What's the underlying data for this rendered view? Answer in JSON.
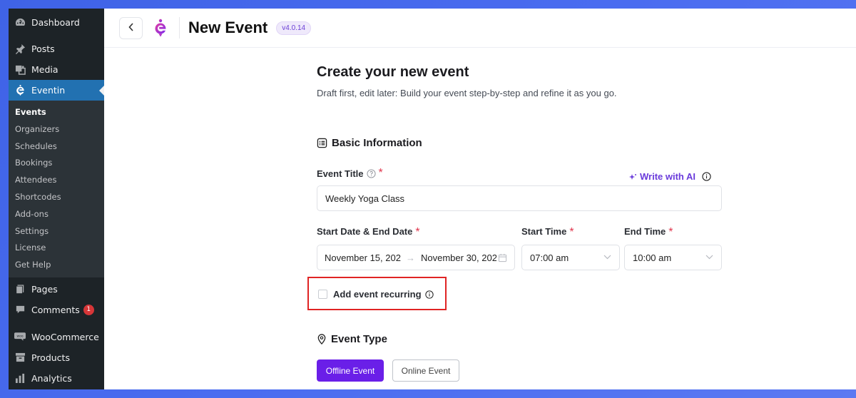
{
  "sidebar": {
    "items_top": [
      {
        "label": "Dashboard",
        "icon": "dashboard-icon"
      },
      {
        "label": "Posts",
        "icon": "pin-icon"
      },
      {
        "label": "Media",
        "icon": "media-icon"
      },
      {
        "label": "Eventin",
        "icon": "eventin-icon"
      }
    ],
    "submenu": [
      "Events",
      "Organizers",
      "Schedules",
      "Bookings",
      "Attendees",
      "Shortcodes",
      "Add-ons",
      "Settings",
      "License",
      "Get Help"
    ],
    "items_bottom": [
      {
        "label": "Pages",
        "icon": "pages-icon"
      },
      {
        "label": "Comments",
        "icon": "comments-icon",
        "count": "1"
      },
      {
        "label": "WooCommerce",
        "icon": "woocommerce-icon"
      },
      {
        "label": "Products",
        "icon": "products-icon"
      },
      {
        "label": "Analytics",
        "icon": "analytics-icon"
      }
    ]
  },
  "header": {
    "back_icon": "‹",
    "title": "New Event",
    "version": "v4.0.14"
  },
  "main": {
    "heading": "Create your new event",
    "subtitle": "Draft first, edit later: Build your event step-by-step and refine it as you go.",
    "basic_info_title": "Basic Information",
    "event_title_label": "Event Title",
    "required_mark": "*",
    "write_ai_label": "Write with AI",
    "event_title_value": "Weekly Yoga Class",
    "date_label": "Start Date & End Date",
    "start_time_label": "Start Time",
    "end_time_label": "End Time",
    "start_date": "November 15, 202",
    "end_date": "November 30, 202",
    "arrow": "→",
    "start_time_value": "07:00 am",
    "end_time_value": "10:00 am",
    "recurring_label": "Add event recurring",
    "event_type_title": "Event Type",
    "offline_btn": "Offline Event",
    "online_btn": "Online Event"
  },
  "colors": {
    "accent": "#6a1fe8",
    "sidebar_bg": "#1d2327",
    "active_menu": "#2271b1",
    "highlight": "#e02424"
  }
}
